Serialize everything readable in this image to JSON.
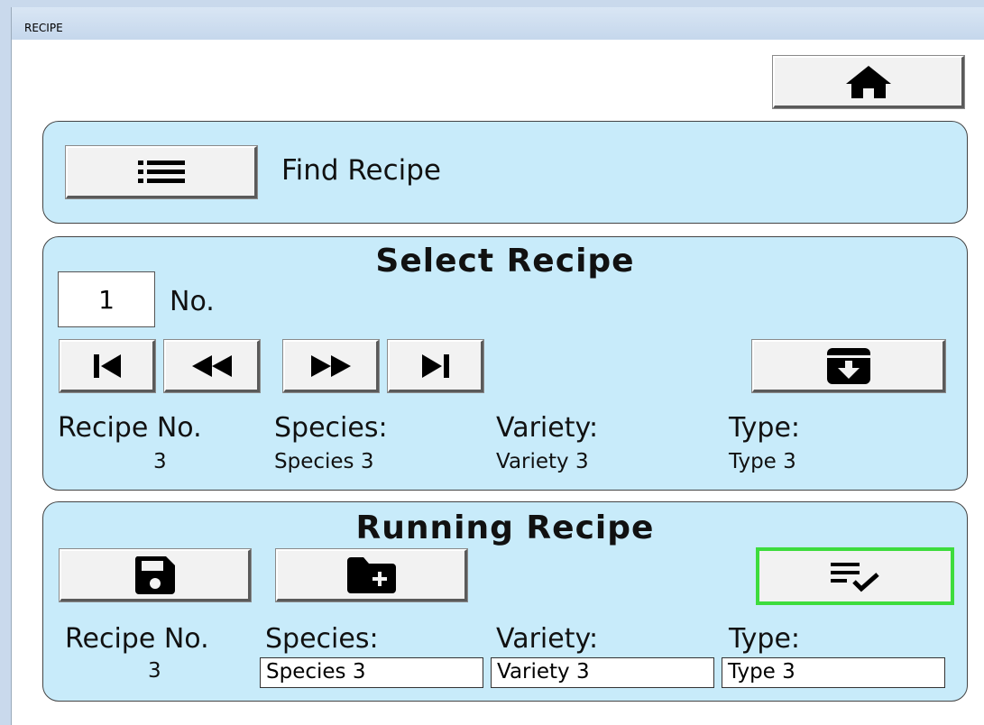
{
  "window": {
    "title": "RECIPE"
  },
  "find": {
    "label": "Find Recipe"
  },
  "select": {
    "heading": "Select Recipe",
    "number_value": "1",
    "number_label": "No.",
    "recipe_no_label": "Recipe No.",
    "recipe_no_value": "3",
    "species_label": "Species:",
    "species_value": "Species 3",
    "variety_label": "Variety:",
    "variety_value": "Variety 3",
    "type_label": "Type:",
    "type_value": "Type 3"
  },
  "running": {
    "heading": "Running Recipe",
    "recipe_no_label": "Recipe No.",
    "recipe_no_value": "3",
    "species_label": "Species:",
    "species_value": "Species 3",
    "variety_label": "Variety:",
    "variety_value": "Variety 3",
    "type_label": "Type:",
    "type_value": "Type 3"
  },
  "icons": {
    "home": "home-icon",
    "list": "list-icon",
    "first": "skip-first-icon",
    "prev": "rewind-icon",
    "next": "fast-forward-icon",
    "last": "skip-last-icon",
    "load": "archive-download-icon",
    "save": "floppy-disk-icon",
    "new_folder": "folder-add-icon",
    "apply": "list-check-icon"
  },
  "colors": {
    "panel": "#c8ebfa",
    "active_outline": "#3ddc3d",
    "button": "#f2f2f2"
  }
}
